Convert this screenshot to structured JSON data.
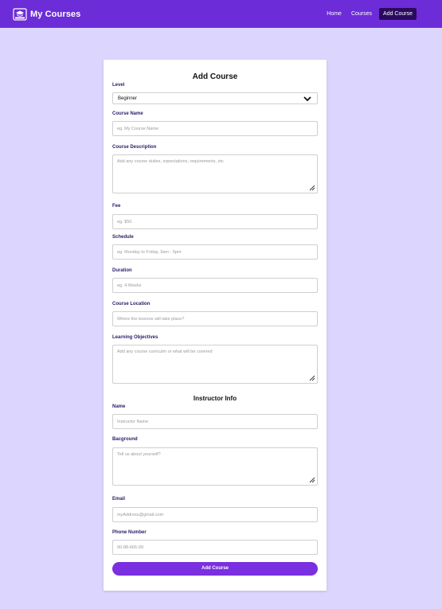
{
  "nav": {
    "brand": "My Courses",
    "links": [
      "Home",
      "Courses",
      "Add Course"
    ],
    "active_link": "Add Course",
    "bg_color": "#6c2dd8"
  },
  "form": {
    "title": "Add Course",
    "level": {
      "label": "Level",
      "value": "Beginner"
    },
    "course_name": {
      "label": "Course Name",
      "placeholder": "eg. My Course Name"
    },
    "course_description": {
      "label": "Course Description",
      "placeholder": "Add any course duties, expectations, requirements, etc"
    },
    "fee": {
      "label": "Fee",
      "placeholder": "eg. $50"
    },
    "schedule": {
      "label": "Schedule",
      "placeholder": "eg. Monday to Friday, 9am - 5pm"
    },
    "duration": {
      "label": "Duration",
      "placeholder": "eg. 4 Weeks"
    },
    "course_location": {
      "label": "Course Location",
      "placeholder": "Where the lessons will take place?"
    },
    "learning_objectives": {
      "label": "Learning Objectives",
      "placeholder": "Add any course curriculm or what will be covered"
    },
    "instructor_title": "Instructor Info",
    "instructor_name": {
      "label": "Name",
      "placeholder": "Instructor Name"
    },
    "background": {
      "label": "Bacground",
      "placeholder": "Tell us about yourself?"
    },
    "email": {
      "label": "Email",
      "placeholder": "myAddress@gmail.com"
    },
    "phone": {
      "label": "Phone Number",
      "placeholder": "00-88-666-99"
    },
    "submit_label": "Add Course",
    "accent_color": "#7a2fe0"
  }
}
